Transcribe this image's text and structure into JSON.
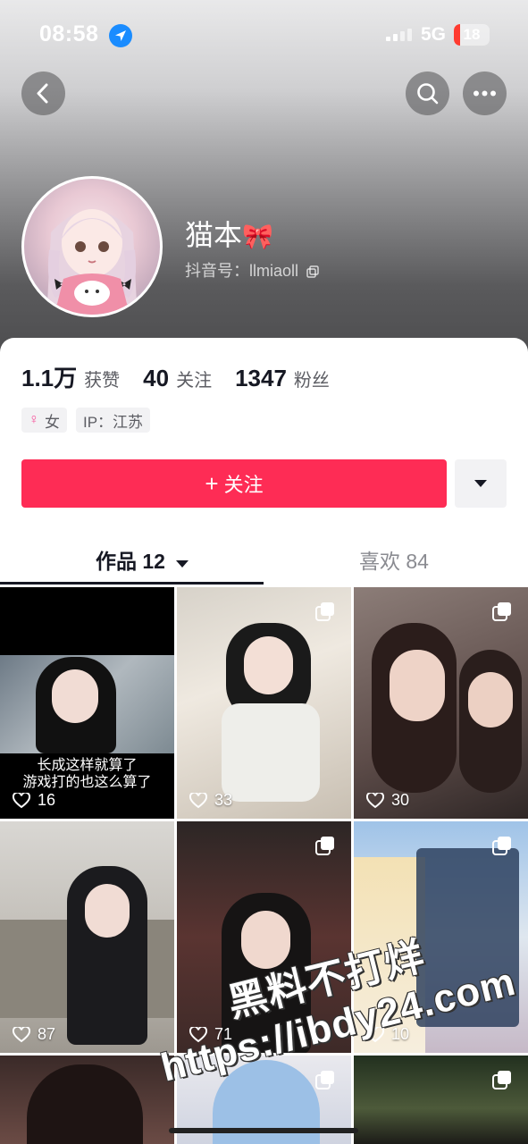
{
  "status_bar": {
    "time": "08:58",
    "network": "5G",
    "battery": "18",
    "battery_level": 0.18
  },
  "profile": {
    "nickname": "猫本",
    "bow_emoji": "🎀",
    "douyin_id": "抖音号：llmiaoll",
    "stats": [
      {
        "value": "1.1万",
        "label": "获赞"
      },
      {
        "value": "40",
        "label": "关注"
      },
      {
        "value": "1347",
        "label": "粉丝"
      }
    ],
    "tags": [
      {
        "icon": "female-icon",
        "text": "女"
      },
      {
        "text": "IP：江苏"
      }
    ]
  },
  "actions": {
    "follow_label": "关注",
    "follow_icon": "plus-icon",
    "accent": "#fe2c55"
  },
  "tabs": {
    "works": "作品 12",
    "likes": "喜欢 84"
  },
  "videos": [
    {
      "likes": "16",
      "caption": [
        "长成这样就算了",
        "游戏打的也这么算了"
      ]
    },
    {
      "likes": "33"
    },
    {
      "likes": "30"
    },
    {
      "likes": "87"
    },
    {
      "likes": "71"
    },
    {
      "likes": "10"
    },
    {
      "likes": ""
    },
    {
      "likes": ""
    },
    {
      "likes": ""
    }
  ],
  "watermark": {
    "line1": "黑料不打烊",
    "line2": "https://ibdy24.com"
  }
}
